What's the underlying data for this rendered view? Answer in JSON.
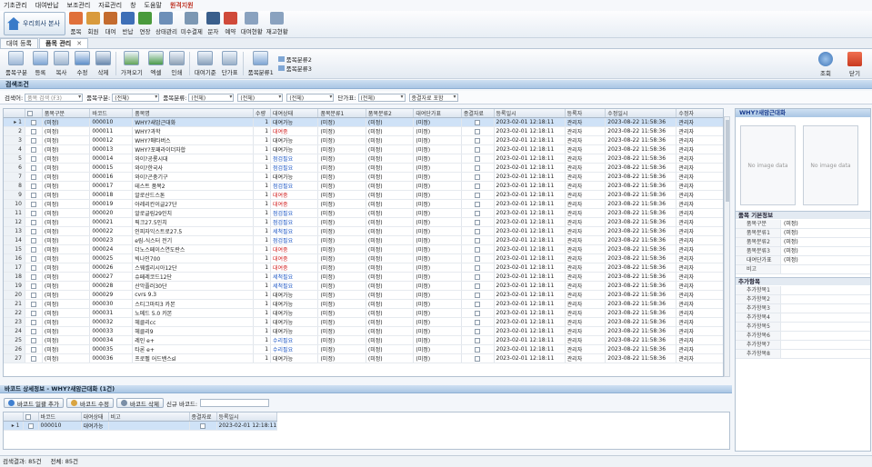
{
  "menubar": [
    "기초관리",
    "대여반납",
    "보조관리",
    "자료관리",
    "창",
    "도움말"
  ],
  "menubar_highlight": "원격지원",
  "logo_text": "우리회사 본사",
  "ribbon_top": [
    {
      "label": "품목",
      "icon": "item-icon",
      "color": "#e0703a"
    },
    {
      "label": "회원",
      "icon": "member-icon",
      "color": "#d99a3c"
    },
    {
      "label": "대여",
      "icon": "rent-icon",
      "color": "#c46b2e"
    },
    {
      "label": "반납",
      "icon": "return-icon",
      "color": "#3e6fb7"
    },
    {
      "label": "연장",
      "icon": "extend-icon",
      "color": "#4a9a3c"
    },
    {
      "label": "상태관리",
      "icon": "status-manage-icon",
      "color": "#6d8fb8"
    },
    {
      "label": "미수결제",
      "icon": "unpaid-icon",
      "color": "#7c97b3"
    },
    {
      "label": "문자",
      "icon": "phone-icon",
      "color": "#3a5f8c"
    },
    {
      "label": "예약",
      "icon": "calendar-icon",
      "color": "#d04a3a"
    },
    {
      "label": "대여현황",
      "icon": "rental-status-icon",
      "color": "#8aa2bf"
    },
    {
      "label": "재고현황",
      "icon": "stock-status-icon",
      "color": "#8aa2bf"
    }
  ],
  "tabs": [
    {
      "label": "대여 등록",
      "active": false
    },
    {
      "label": "품목 관리",
      "active": true
    }
  ],
  "ribbon_sub": [
    {
      "label": "품목구분",
      "icon": "category-icon"
    },
    {
      "label": "등록",
      "icon": "register-icon"
    },
    {
      "label": "복사",
      "icon": "copy-icon"
    },
    {
      "label": "수정",
      "icon": "edit-icon"
    },
    {
      "label": "삭제",
      "icon": "delete-icon"
    },
    {
      "label": "가져오기",
      "icon": "import-icon"
    },
    {
      "label": "엑셀",
      "icon": "excel-icon"
    },
    {
      "label": "인쇄",
      "icon": "print-icon"
    },
    {
      "label": "대여기준",
      "icon": "rent-standard-icon"
    },
    {
      "label": "단가표",
      "icon": "price-table-icon"
    },
    {
      "label": "품목분류1",
      "icon": "item-class1-icon"
    }
  ],
  "ribbon_sub_side": [
    "품목분류2",
    "품목분류3"
  ],
  "lookup_label": "조회",
  "close_label": "닫기",
  "search_section_title": "검색조건",
  "filters": {
    "keyword_label": "검색어:",
    "keyword_placeholder": "품목 검색 (F3)",
    "category_label": "품목구분:",
    "category_value": "(전체)",
    "class_label": "품목분류:",
    "class1_value": "(전체)",
    "class2_value": "(전체)",
    "class3_value": "(전체)",
    "price_label": "단가표:",
    "price_value": "(전체)",
    "closed_value": "종결자료 포함"
  },
  "grid_columns": [
    "품목구분",
    "바코드",
    "품목명",
    "수량",
    "대여상태",
    "품목분류1",
    "품목분류2",
    "대여단가표",
    "종결자료",
    "등록일시",
    "등록자",
    "수정일시",
    "수정자"
  ],
  "grid_rows": [
    [
      "1",
      "(미정)",
      "000010",
      "WHY?새암근대화",
      "1",
      "대여가능",
      "(미정)",
      "(미정)",
      "(미정)",
      "2023-02-01 12:18:11",
      "관리자",
      "2023-08-22 11:58:36",
      "관리자"
    ],
    [
      "2",
      "(미정)",
      "000011",
      "WHY?과학",
      "1",
      "대여중",
      "(미정)",
      "(미정)",
      "(미정)",
      "2023-02-01 12:18:11",
      "관리자",
      "2023-08-22 11:58:36",
      "관리자"
    ],
    [
      "3",
      "(미정)",
      "000012",
      "WHY?매타버스",
      "1",
      "대여가능",
      "(미정)",
      "(미정)",
      "(미정)",
      "2023-02-01 12:18:11",
      "관리자",
      "2023-08-22 11:58:36",
      "관리자"
    ],
    [
      "4",
      "(미정)",
      "000013",
      "WHY?포패라이더자합",
      "1",
      "대여가능",
      "(미정)",
      "(미정)",
      "(미정)",
      "2023-02-01 12:18:11",
      "관리자",
      "2023-08-22 11:58:36",
      "관리자"
    ],
    [
      "5",
      "(미정)",
      "000014",
      "와이?공룡시대",
      "1",
      "점검필요",
      "(미정)",
      "(미정)",
      "(미정)",
      "2023-02-01 12:18:11",
      "관리자",
      "2023-08-22 11:58:36",
      "관리자"
    ],
    [
      "6",
      "(미정)",
      "000015",
      "와이?한국사",
      "1",
      "점검필요",
      "(미정)",
      "(미정)",
      "(미정)",
      "2023-02-01 12:18:11",
      "관리자",
      "2023-08-22 11:58:36",
      "관리자"
    ],
    [
      "7",
      "(미정)",
      "000016",
      "와이?곤충기구",
      "1",
      "대여가능",
      "(미정)",
      "(미정)",
      "(미정)",
      "2023-02-01 12:18:11",
      "관리자",
      "2023-08-22 11:58:36",
      "관리자"
    ],
    [
      "8",
      "(미정)",
      "000017",
      "테스트 품목2",
      "1",
      "점검필요",
      "(미정)",
      "(미정)",
      "(미정)",
      "2023-02-01 12:18:11",
      "관리자",
      "2023-08-22 11:58:36",
      "관리자"
    ],
    [
      "9",
      "(미정)",
      "000018",
      "알로산드스톤",
      "1",
      "대여중",
      "(미정)",
      "(미정)",
      "(미정)",
      "2023-02-01 12:18:11",
      "관리자",
      "2023-08-22 11:58:36",
      "관리자"
    ],
    [
      "10",
      "(미정)",
      "000019",
      "아레리칸이글27단",
      "1",
      "대여중",
      "(미정)",
      "(미정)",
      "(미정)",
      "2023-02-01 12:18:11",
      "관리자",
      "2023-08-22 11:58:36",
      "관리자"
    ],
    [
      "11",
      "(미정)",
      "000020",
      "알로글림29인치",
      "1",
      "점검필요",
      "(미정)",
      "(미정)",
      "(미정)",
      "2023-02-01 12:18:11",
      "관리자",
      "2023-08-22 11:58:36",
      "관리자"
    ],
    [
      "12",
      "(미정)",
      "000021",
      "픽크27.5인치",
      "1",
      "점검필요",
      "(미정)",
      "(미정)",
      "(미정)",
      "2023-02-01 12:18:11",
      "관리자",
      "2023-08-22 11:58:36",
      "관리자"
    ],
    [
      "13",
      "(미정)",
      "000022",
      "인피자익스트로27.5",
      "1",
      "세척필요",
      "(미정)",
      "(미정)",
      "(미정)",
      "2023-02-01 12:18:11",
      "관리자",
      "2023-08-22 11:58:36",
      "관리자"
    ],
    [
      "14",
      "(미정)",
      "000023",
      "e림-식스터 전기",
      "1",
      "점검필요",
      "(미정)",
      "(미정)",
      "(미정)",
      "2023-02-01 12:18:11",
      "관리자",
      "2023-08-22 11:58:36",
      "관리자"
    ],
    [
      "15",
      "(미정)",
      "000024",
      "더노스페이스연도란스",
      "1",
      "대여중",
      "(미정)",
      "(미정)",
      "(미정)",
      "2023-02-01 12:18:11",
      "관리자",
      "2023-08-22 11:58:36",
      "관리자"
    ],
    [
      "16",
      "(미정)",
      "000025",
      "빅나인700",
      "1",
      "대여중",
      "(미정)",
      "(미정)",
      "(미정)",
      "2023-02-01 12:18:11",
      "관리자",
      "2023-08-22 11:58:36",
      "관리자"
    ],
    [
      "17",
      "(미정)",
      "000026",
      "스웨셀리시아12단",
      "1",
      "대여중",
      "(미정)",
      "(미정)",
      "(미정)",
      "2023-02-01 12:18:11",
      "관리자",
      "2023-08-22 11:58:36",
      "관리자"
    ],
    [
      "18",
      "(미정)",
      "000027",
      "슈페레코드12단",
      "1",
      "세척필요",
      "(미정)",
      "(미정)",
      "(미정)",
      "2023-02-01 12:18:11",
      "관리자",
      "2023-08-22 11:58:36",
      "관리자"
    ],
    [
      "19",
      "(미정)",
      "000028",
      "산악플러30단",
      "1",
      "세척필요",
      "(미정)",
      "(미정)",
      "(미정)",
      "2023-02-01 12:18:11",
      "관리자",
      "2023-08-22 11:58:36",
      "관리자"
    ],
    [
      "20",
      "(미정)",
      "000029",
      "cvrs 9.3",
      "1",
      "대여가능",
      "(미정)",
      "(미정)",
      "(미정)",
      "2023-02-01 12:18:11",
      "관리자",
      "2023-08-22 11:58:36",
      "관리자"
    ],
    [
      "21",
      "(미정)",
      "000030",
      "스티그마티3 카본",
      "1",
      "대여가능",
      "(미정)",
      "(미정)",
      "(미정)",
      "2023-02-01 12:18:11",
      "관리자",
      "2023-08-22 11:58:36",
      "관리자"
    ],
    [
      "22",
      "(미정)",
      "000031",
      "노메드 5.0 카본",
      "1",
      "대여가능",
      "(미정)",
      "(미정)",
      "(미정)",
      "2023-02-01 12:18:11",
      "관리자",
      "2023-08-22 11:58:36",
      "관리자"
    ],
    [
      "23",
      "(미정)",
      "000032",
      "헤클리cc",
      "1",
      "대여가능",
      "(미정)",
      "(미정)",
      "(미정)",
      "2023-02-01 12:18:11",
      "관리자",
      "2023-08-22 11:58:36",
      "관리자"
    ],
    [
      "24",
      "(미정)",
      "000033",
      "헤클리9",
      "1",
      "대여가능",
      "(미정)",
      "(미정)",
      "(미정)",
      "2023-02-01 12:18:11",
      "관리자",
      "2023-08-22 11:58:36",
      "관리자"
    ],
    [
      "25",
      "(미정)",
      "000034",
      "레인 e+",
      "1",
      "수리필요",
      "(미정)",
      "(미정)",
      "(미정)",
      "2023-02-01 12:18:11",
      "관리자",
      "2023-08-22 11:58:36",
      "관리자"
    ],
    [
      "26",
      "(미정)",
      "000035",
      "타론 e+",
      "1",
      "수리필요",
      "(미정)",
      "(미정)",
      "(미정)",
      "2023-02-01 12:18:11",
      "관리자",
      "2023-08-22 11:58:36",
      "관리자"
    ],
    [
      "27",
      "(미정)",
      "000036",
      "프로펠 어드밴스sl",
      "1",
      "대여가능",
      "(미정)",
      "(미정)",
      "(미정)",
      "2023-02-01 12:18:11",
      "관리자",
      "2023-08-22 11:58:36",
      "관리자"
    ]
  ],
  "status_colors": {
    "대여가능": "#222222",
    "대여중": "#d22222",
    "점검필요": "#1a55c4",
    "세척필요": "#1a55c4",
    "수리필요": "#1a55c4"
  },
  "right_panel": {
    "title": "WHY?새암근대화",
    "no_image": "No image data",
    "basic_title": "품목 기본정보",
    "basic_rows": [
      {
        "k": "품목구분",
        "v": "(미정)"
      },
      {
        "k": "품목분류1",
        "v": "(미정)"
      },
      {
        "k": "품목분류2",
        "v": "(미정)"
      },
      {
        "k": "품목분류3",
        "v": "(미정)"
      },
      {
        "k": "대여단가표",
        "v": "(미정)"
      },
      {
        "k": "비고",
        "v": ""
      }
    ],
    "extra_title": "추가항목",
    "extra_rows": [
      "추가항목1",
      "추가항목2",
      "추가항목3",
      "추가항목4",
      "추가항목5",
      "추가항목6",
      "추가항목7",
      "추가항목8"
    ]
  },
  "barcode_section": {
    "title": "바코드 상세정보 - WHY?새암근대화 (1건)",
    "add_label": "바코드 일괄 추가",
    "edit_label": "바코드 수정",
    "delete_label": "바코드 삭제",
    "new_label": "신규 바코드:",
    "columns": [
      "바코드",
      "대여상태",
      "비고",
      "종결자료",
      "등록일시"
    ],
    "rows": [
      [
        "1",
        "000010",
        "대여가능",
        "",
        "2023-02-01 12:18:11"
      ]
    ]
  },
  "status_bar": {
    "result": "검색결과: 85건",
    "total": "전체: 85건"
  }
}
